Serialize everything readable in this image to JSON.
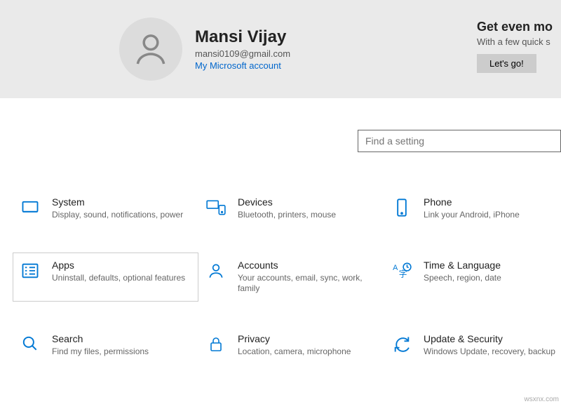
{
  "profile": {
    "name": "Mansi Vijay",
    "email": "mansi0109@gmail.com",
    "account_link": "My Microsoft account"
  },
  "promo": {
    "title": "Get even mo",
    "sub": "With a few quick s",
    "button": "Let's go!"
  },
  "search": {
    "placeholder": "Find a setting"
  },
  "tiles": {
    "system": {
      "title": "System",
      "desc": "Display, sound, notifications, power"
    },
    "devices": {
      "title": "Devices",
      "desc": "Bluetooth, printers, mouse"
    },
    "phone": {
      "title": "Phone",
      "desc": "Link your Android, iPhone"
    },
    "apps": {
      "title": "Apps",
      "desc": "Uninstall, defaults, optional features"
    },
    "accounts": {
      "title": "Accounts",
      "desc": "Your accounts, email, sync, work, family"
    },
    "time": {
      "title": "Time & Language",
      "desc": "Speech, region, date"
    },
    "search": {
      "title": "Search",
      "desc": "Find my files, permissions"
    },
    "privacy": {
      "title": "Privacy",
      "desc": "Location, camera, microphone"
    },
    "update": {
      "title": "Update & Security",
      "desc": "Windows Update, recovery, backup"
    }
  },
  "watermark": "wsxnx.com"
}
